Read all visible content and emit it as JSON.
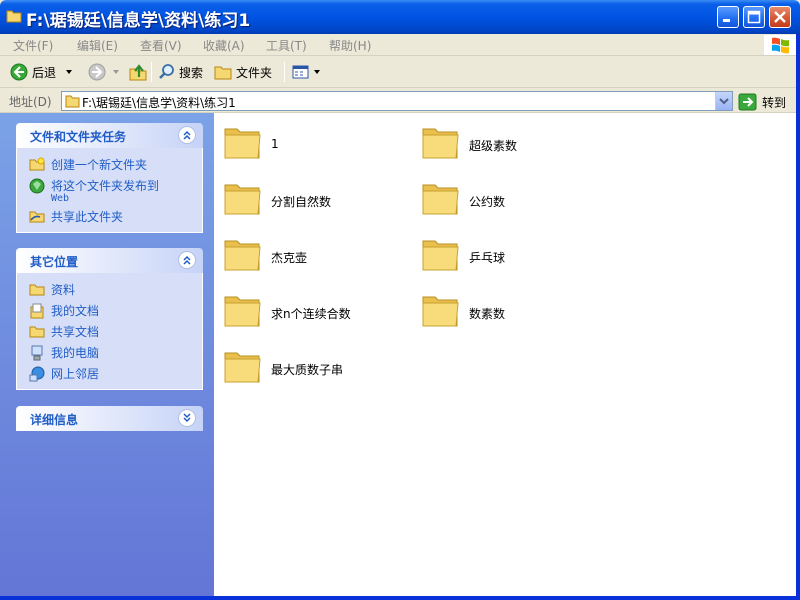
{
  "window": {
    "title": "F:\\琚锡廷\\信息学\\资料\\练习1"
  },
  "menu": {
    "items": [
      "文件(F)",
      "编辑(E)",
      "查看(V)",
      "收藏(A)",
      "工具(T)",
      "帮助(H)"
    ]
  },
  "toolbar": {
    "back_label": "后退",
    "search_label": "搜索",
    "folders_label": "文件夹"
  },
  "address": {
    "label": "地址(D)",
    "value": "F:\\琚锡廷\\信息学\\资料\\练习1",
    "go_label": "转到"
  },
  "taskpane": {
    "file_tasks": {
      "title": "文件和文件夹任务",
      "items": [
        "创建一个新文件夹",
        "将这个文件夹发布到",
        "Web",
        "共享此文件夹"
      ]
    },
    "other_places": {
      "title": "其它位置",
      "items": [
        "资料",
        "我的文档",
        "共享文档",
        "我的电脑",
        "网上邻居"
      ]
    },
    "details": {
      "title": "详细信息"
    }
  },
  "folders": [
    "1",
    "超级素数",
    "分割自然数",
    "公约数",
    "杰克壶",
    "乒乓球",
    "求n个连续合数",
    "数素数",
    "最大质数子串"
  ],
  "colors": {
    "titlebar": "#0054e3",
    "taskpane_top": "#7ba2e7",
    "taskpane_bottom": "#6375d6",
    "link": "#215dc6",
    "folder_yellow": "#f6d873"
  }
}
